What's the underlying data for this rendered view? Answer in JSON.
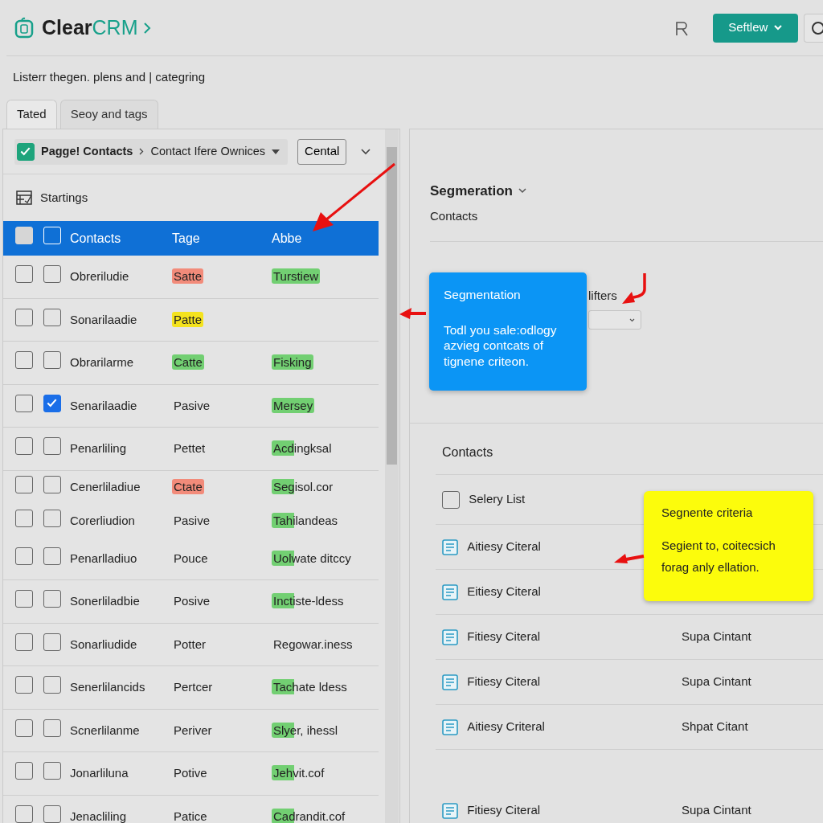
{
  "header": {
    "logo_text": "Clear",
    "logo_accent": "CRM",
    "button": "Seftlew"
  },
  "subtitle": "Listerr thegen. plens and | categring",
  "tabs": [
    {
      "label": "Tated",
      "selected": true
    },
    {
      "label": "Seoy and tags",
      "selected": false
    }
  ],
  "toolbar": {
    "checked": true,
    "breadcrumb_root": "Pagge! Contacts",
    "breadcrumb_leaf": "Contact Ifere Ownices",
    "button": "Cental"
  },
  "section_label": "Startings",
  "table": {
    "header_checks": [
      {
        "checked": false,
        "disabled": true
      },
      {
        "checked": false,
        "disabled": false
      }
    ],
    "columns": [
      "Contacts",
      "Tage",
      "Abbe"
    ],
    "rows": [
      {
        "flagged": false,
        "checked": false,
        "compact": false,
        "name": "Obreriludie",
        "tage": {
          "text": "Satte",
          "color": "#f28b7a",
          "partial": false
        },
        "abbe": {
          "text": "Turstiew",
          "color": "#72cf72",
          "partial": false
        }
      },
      {
        "flagged": false,
        "checked": false,
        "compact": false,
        "name": "Sonarilaadie",
        "tage": {
          "text": "Patte",
          "color": "#f4e31e",
          "partial": false
        }
      },
      {
        "flagged": false,
        "checked": false,
        "compact": false,
        "name": "Obrarilarme",
        "tage": {
          "text": "Catte",
          "color": "#72cf72",
          "partial": false
        },
        "abbe": {
          "text": "Fisking",
          "color": "#72cf72",
          "partial": false
        }
      },
      {
        "flagged": false,
        "checked": true,
        "compact": false,
        "name": "Senarilaadie",
        "tage": {
          "text": "Pasive"
        },
        "abbe": {
          "text": "Mersey",
          "color": "#72cf72",
          "partial": false
        }
      },
      {
        "flagged": false,
        "checked": false,
        "compact": false,
        "name": "Penarliling",
        "tage": {
          "text": "Pettet"
        },
        "abbe": {
          "text": "Acdingksal",
          "color": "#72cf72",
          "partial": true
        }
      },
      {
        "flagged": false,
        "checked": false,
        "compact": true,
        "name": "Cenerliladiue",
        "tage": {
          "text": "Ctate",
          "color": "#f28b7a",
          "partial": false
        },
        "abbe": {
          "text": "Segisol.cor",
          "color": "#72cf72",
          "partial": true
        }
      },
      {
        "flagged": false,
        "checked": false,
        "compact": true,
        "name": "Corerliudion",
        "tage": {
          "text": "Pasive"
        },
        "abbe": {
          "text": "Tahilandeas",
          "color": "#72cf72",
          "partial": true
        }
      },
      {
        "flagged": false,
        "checked": false,
        "compact": false,
        "name": "Penarlladiuo",
        "tage": {
          "text": "Pouce"
        },
        "abbe": {
          "text": "Uolwate ditccy",
          "color": "#72cf72",
          "partial": true
        }
      },
      {
        "flagged": false,
        "checked": false,
        "compact": false,
        "name": "Sonerliladbie",
        "tage": {
          "text": "Posive"
        },
        "abbe": {
          "text": "Inctiste-ldess",
          "color": "#72cf72",
          "partial": true
        }
      },
      {
        "flagged": false,
        "checked": false,
        "compact": false,
        "name": "Sonarliudide",
        "tage": {
          "text": "Potter"
        },
        "abbe": {
          "text": "Regowar.iness"
        }
      },
      {
        "flagged": false,
        "checked": false,
        "compact": false,
        "name": "Senerlilancids",
        "tage": {
          "text": "Pertcer"
        },
        "abbe": {
          "text": "Tachate ldess",
          "color": "#72cf72",
          "partial": true
        }
      },
      {
        "flagged": false,
        "checked": false,
        "compact": false,
        "name": "Scnerlilanme",
        "tage": {
          "text": "Periver"
        },
        "abbe": {
          "text": "Slyer, ihessl",
          "color": "#72cf72",
          "partial": true
        }
      },
      {
        "flagged": false,
        "checked": false,
        "compact": false,
        "name": "Jonarliluna",
        "tage": {
          "text": "Potive"
        },
        "abbe": {
          "text": "Jehvit.cof",
          "color": "#72cf72",
          "partial": true
        }
      },
      {
        "flagged": false,
        "checked": false,
        "compact": false,
        "name": "Jenacliling",
        "tage": {
          "text": "Patice"
        },
        "abbe": {
          "text": "Cadrandit.cof",
          "color": "#72cf72",
          "partial": true
        }
      }
    ]
  },
  "segmentation": {
    "title": "Segmeration",
    "subtitle": "Contacts",
    "filters_label": "lifters"
  },
  "blue_callout": {
    "title": "Segmentation",
    "body": "Todl you sale:odlogy azvieg contcats of tignene criteon."
  },
  "contacts_list": {
    "title": "Contacts",
    "items": [
      {
        "kind": "checkbox",
        "label": "Selery List",
        "checked": false
      },
      {
        "kind": "doc",
        "label": "Aitiesy Citeral"
      },
      {
        "kind": "doc",
        "label": "Eitiesy Citeral"
      },
      {
        "kind": "doc",
        "label": "Fitiesy Citeral",
        "value": "Supa Cintant"
      },
      {
        "kind": "doc",
        "label": "Fitiesy Citeral",
        "value": "Supa Cintant"
      },
      {
        "kind": "doc",
        "label": "Aitiesy Criteral",
        "value": "Shpat Citant"
      },
      {
        "kind": "doc",
        "label": "Fitiesy Citeral",
        "value": "Supa Cintant"
      }
    ]
  },
  "yellow_callout": {
    "title": "Segnente criteria",
    "body": "Segient to, coitecsich forag anly ellation."
  }
}
